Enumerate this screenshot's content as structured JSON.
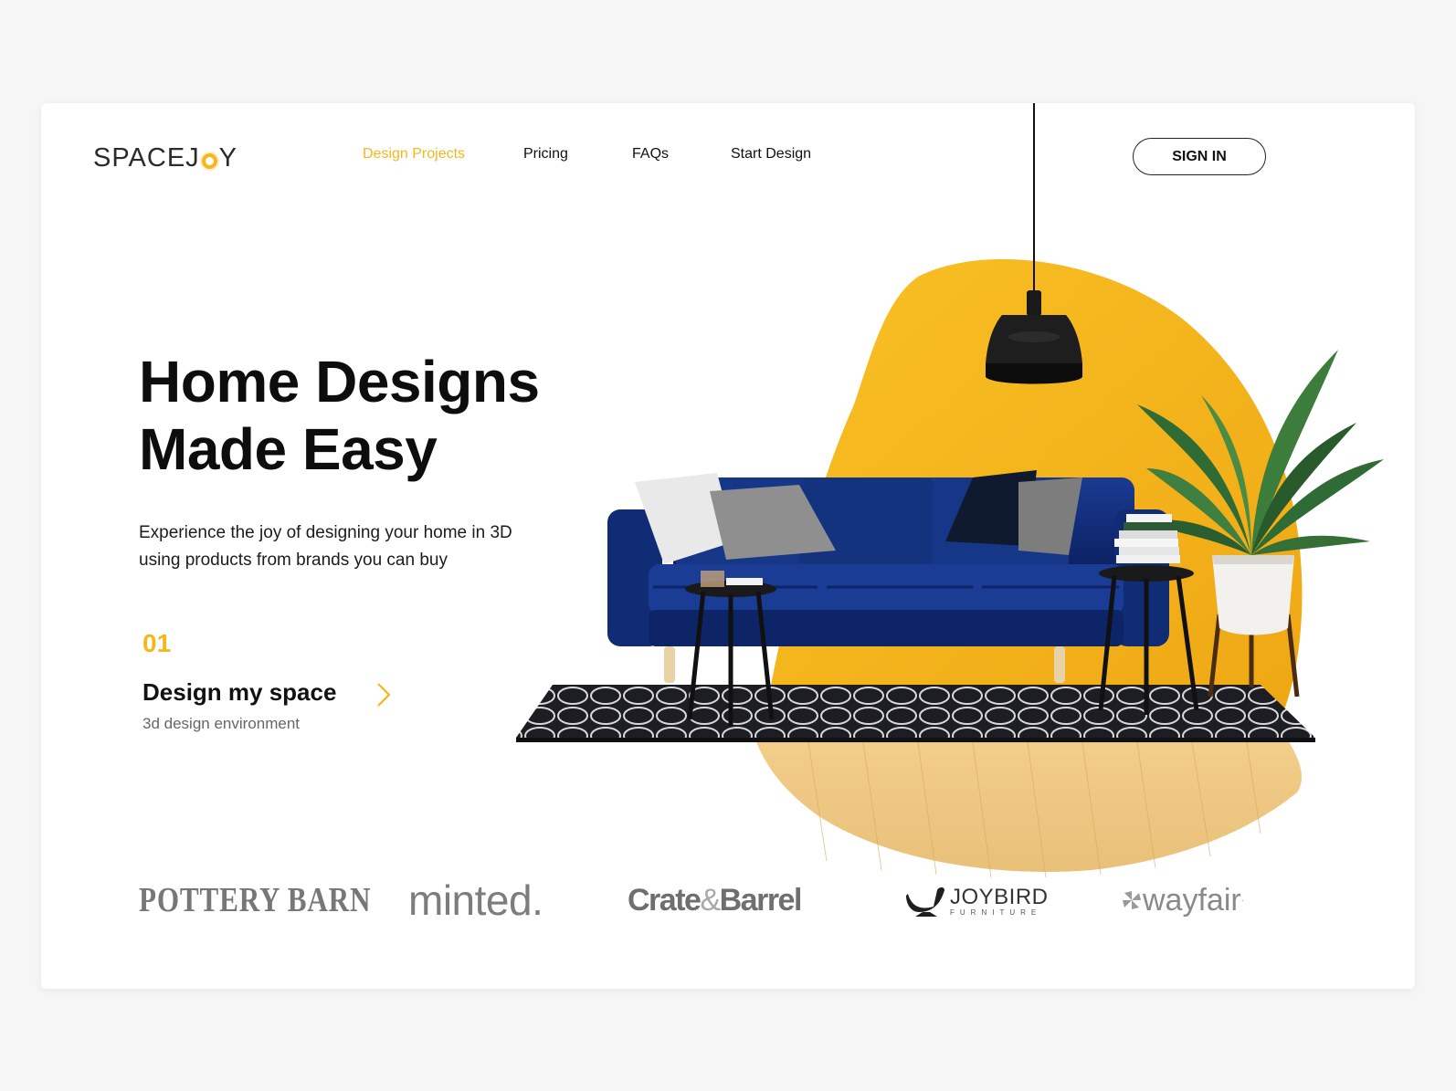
{
  "header": {
    "logo_text_left": "SPACEJ",
    "logo_text_right": "Y",
    "nav": [
      {
        "label": "Design Projects",
        "active": true
      },
      {
        "label": "Pricing",
        "active": false
      },
      {
        "label": "FAQs",
        "active": false
      },
      {
        "label": "Start Design",
        "active": false
      }
    ],
    "signin_label": "SIGN IN"
  },
  "hero": {
    "title_line1": "Home Designs",
    "title_line2": "Made Easy",
    "subtitle_line1": "Experience the joy of designing your home in 3D",
    "subtitle_line2": "using products from brands you can buy",
    "step": {
      "number": "01",
      "title": "Design my space",
      "description": "3d design environment",
      "arrow_icon": "chevron-right-icon"
    }
  },
  "brands": {
    "pottery_barn": "POTTERY BARN",
    "minted": "minted.",
    "crate_left": "Crate",
    "crate_amp": "&",
    "crate_right": "Barrel",
    "joybird_name": "JOYBIRD",
    "joybird_sub": "FURNITURE",
    "wayfair": "wayfair",
    "wayfair_mark": "·"
  },
  "colors": {
    "accent": "#f5b81c",
    "sofa": "#0f2a78",
    "text": "#111111",
    "background": "#f6f6f6"
  }
}
